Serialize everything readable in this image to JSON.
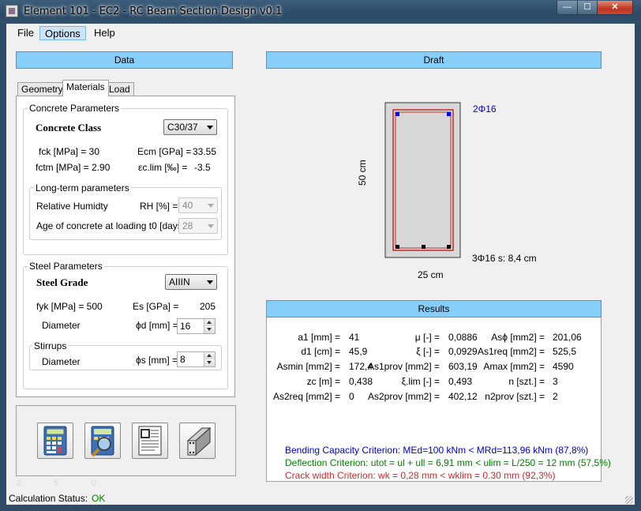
{
  "window": {
    "title": "Element 101 - EC2 - RC Beam Section Design v0.1",
    "min": "—",
    "max": "☐",
    "close": "✕"
  },
  "menu": [
    "File",
    "Options",
    "Help"
  ],
  "data_header": "Data",
  "draft_header": "Draft",
  "results_header": "Results",
  "tabs": [
    "Geometry",
    "Materials",
    "Load"
  ],
  "concrete": {
    "group": "Concrete Parameters",
    "class_label": "Concrete Class",
    "class_value": "C30/37",
    "fck": "fck [MPa] = 30",
    "ecm_label": "Ecm [GPa] =",
    "ecm_value": "33.55",
    "fctm": "fctm [MPa] = 2.90",
    "eclim_label": "εc.lim [‰] =",
    "eclim_value": "-3.5",
    "longterm_group": "Long-term parameters",
    "rh_label": "Relative Humidty",
    "rh_unit": "RH [%] =",
    "rh_value": "40",
    "age_label": "Age of concrete at loading t0 [days] =",
    "age_value": "28"
  },
  "steel": {
    "group": "Steel Parameters",
    "grade_label": "Steel Grade",
    "grade_value": "AIIIN",
    "fyk": "fyk [MPa] = 500",
    "es_label": "Es [GPa] =",
    "es_value": "205",
    "diam_label": "Diameter",
    "phid_label": "ϕd [mm] =",
    "phid_value": "16",
    "stirrups_group": "Stirrups",
    "stirrup_diam_label": "Diameter",
    "phis_label": "ϕs [mm] =",
    "phis_value": "8"
  },
  "tools": {
    "calc": "calculator-icon",
    "inspect": "magnifier-calculator-icon",
    "report": "report-icon",
    "section3d": "beam-3d-icon"
  },
  "ghost_numbers": [
    "2",
    "5",
    "0"
  ],
  "draft": {
    "top_bars": "2Φ16",
    "bottom_bars": "3Φ16 s: 8,4 cm",
    "height": "50 cm",
    "width": "25 cm",
    "colors": {
      "rebar_top": "#0000ff",
      "rebar_bottom": "#000000",
      "stirrup": "#c00000",
      "section_fill": "#d8d8d8"
    }
  },
  "results": {
    "rows": [
      [
        {
          "l": "a1 [mm] =",
          "v": "41"
        },
        {
          "l": "μ [-] =",
          "v": "0,0886"
        },
        {
          "l": "Asϕ [mm2] =",
          "v": "201,06"
        }
      ],
      [
        {
          "l": "d1 [cm] =",
          "v": "45,9"
        },
        {
          "l": "ξ [-] =",
          "v": "0,0929"
        },
        {
          "l": "As1req [mm2] =",
          "v": "525,5"
        }
      ],
      [
        {
          "l": "Asmin [mm2] =",
          "v": "172,4"
        },
        {
          "l": "As1prov [mm2] =",
          "v": "603,19"
        },
        {
          "l": "Amax [mm2] =",
          "v": "4590"
        }
      ],
      [
        {
          "l": "zc [m] =",
          "v": "0,438"
        },
        {
          "l": "ξ.lim [-] =",
          "v": "0,493"
        },
        {
          "l": "n [szt.] =",
          "v": "3"
        }
      ],
      [
        {
          "l": "As2req [mm2] =",
          "v": "0"
        },
        {
          "l": "As2prov [mm2] =",
          "v": "402,12"
        },
        {
          "l": "n2prov [szt.] =",
          "v": "2"
        }
      ]
    ],
    "bending": "Bending Capacity Criterion: MEd=100 kNm < MRd=113,96 kNm   (87,8%)",
    "deflection": "Deflection Criterion: utot = ul + ull = 6,91 mm < ulim = L/250 = 12 mm   (57,5%)",
    "crack": "Crack width Criterion: wk = 0,28 mm < wklim = 0.30 mm   (92,3%)",
    "colors": {
      "bending": "#0000cc",
      "deflection": "#008000",
      "crack": "#c03030"
    }
  },
  "status": {
    "label": "Calculation Status:",
    "value": "OK",
    "color": "#008000"
  }
}
